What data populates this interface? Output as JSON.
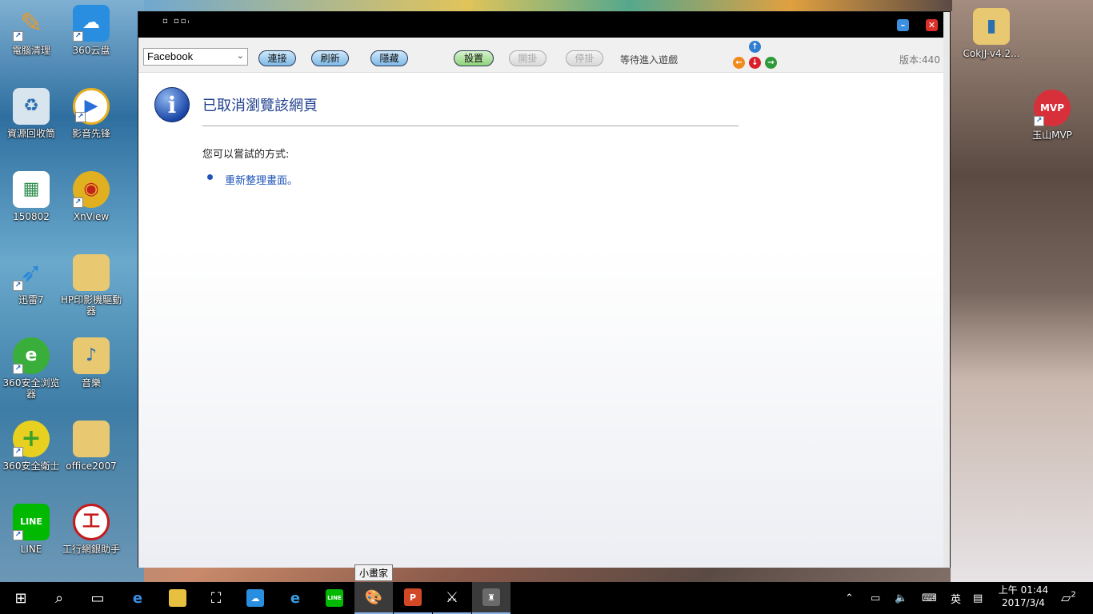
{
  "desktop": {
    "icons": [
      {
        "label": "電腦清理",
        "color": "#e89a2a",
        "icon": "broom-icon",
        "symbol": "✎"
      },
      {
        "label": "360云盘",
        "color": "#2a8ee0",
        "icon": "cloud-icon",
        "symbol": "☁"
      },
      {
        "label": "資源回收筒",
        "color": "#d8e4ee",
        "icon": "recycle-bin-icon",
        "symbol": "♻"
      },
      {
        "label": "影音先锋",
        "color": "#2a6fd8",
        "icon": "play-icon",
        "symbol": "▶"
      },
      {
        "label": "150802",
        "color": "#2f8f4f",
        "icon": "spreadsheet-icon",
        "symbol": "▦"
      },
      {
        "label": "XnView",
        "color": "#e0b020",
        "icon": "eye-icon",
        "symbol": "◉"
      },
      {
        "label": "迅雷7",
        "color": "#2b88d8",
        "icon": "bird-icon",
        "symbol": "➶"
      },
      {
        "label": "HP印影機驅動器",
        "color": "#e8c870",
        "icon": "folder-icon",
        "symbol": ""
      },
      {
        "label": "360安全浏览器",
        "color": "#3aae3a",
        "icon": "browser-icon",
        "symbol": "e"
      },
      {
        "label": "音樂",
        "color": "#e8c870",
        "icon": "music-folder-icon",
        "symbol": "♪"
      },
      {
        "label": "360安全衛士",
        "color": "#5abb2a",
        "icon": "shield-plus-icon",
        "symbol": "+"
      },
      {
        "label": "office2007",
        "color": "#e8c870",
        "icon": "folder-icon",
        "symbol": ""
      },
      {
        "label": "LINE",
        "color": "#00b900",
        "icon": "line-icon",
        "symbol": "LINE"
      },
      {
        "label": "工行網銀助手",
        "color": "#c41a1a",
        "icon": "bank-icon",
        "symbol": "工"
      },
      {
        "label": "CokJJ-v4.2...",
        "color": "#e8c870",
        "icon": "zip-folder-icon",
        "symbol": ""
      },
      {
        "label": "玉山MVP",
        "color": "#d8303a",
        "icon": "mvp-icon",
        "symbol": "MVP"
      }
    ]
  },
  "window": {
    "logo_text": "▫ ▫▫ᵢ",
    "minimize_symbol": "–",
    "close_symbol": "✕"
  },
  "toolbar": {
    "server_select": "Facebook",
    "connect": "連接",
    "refresh": "刷新",
    "hide": "隱藏",
    "settings": "設置",
    "start_hook": "開掛",
    "stop_hook": "停掛",
    "status": "等待進入遊戲",
    "version": "版本:440"
  },
  "page": {
    "title": "已取消瀏覽該網頁",
    "try_text": "您可以嘗試的方式:",
    "refresh_link": "重新整理畫面。"
  },
  "taskbar": {
    "tooltip": "小畫家",
    "ime": "英",
    "time": "上午 01:44",
    "date": "2017/3/4",
    "notification_count": "2"
  }
}
